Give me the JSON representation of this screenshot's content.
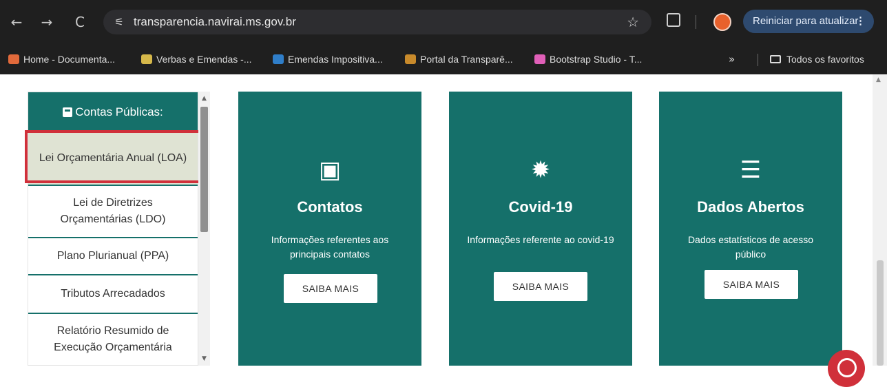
{
  "browser": {
    "nav": {
      "back_icon": "←",
      "forward_icon": "→",
      "reload_icon": "C"
    },
    "site_info_icon": "⚟",
    "url": "transparencia.navirai.ms.gov.br",
    "star_icon": "☆",
    "update_button": "Reiniciar para atualizar",
    "update_menu": "⋮"
  },
  "bookmarks": {
    "items": [
      {
        "label": "Home - Documenta...",
        "color": "#e26a3b"
      },
      {
        "label": "Verbas e Emendas -...",
        "color": "#d6b84a"
      },
      {
        "label": "Emendas Impositiva...",
        "color": "#2f7ec9"
      },
      {
        "label": "Portal da Transparê...",
        "color": "#c88a2b"
      },
      {
        "label": "Bootstrap Studio - T...",
        "color": "#e05fb8"
      }
    ],
    "more": "»",
    "all_label": "Todos os favoritos"
  },
  "sidebar": {
    "title": "Contas Públicas:",
    "items": [
      {
        "label": "Lei Orçamentária Anual (LOA)"
      },
      {
        "label": "Lei de Diretrizes Orçamentárias (LDO)"
      },
      {
        "label": "Plano Plurianual (PPA)"
      },
      {
        "label": "Tributos Arrecadados"
      },
      {
        "label": "Relatório Resumido de Execução Orçamentária"
      }
    ],
    "scroll_up": "▲",
    "scroll_down": "▼"
  },
  "cards": [
    {
      "icon": "▣",
      "title": "Contatos",
      "desc": "Informações referentes aos principais contatos",
      "button": "SAIBA MAIS"
    },
    {
      "icon": "✹",
      "title": "Covid-19",
      "desc": "Informações referente ao covid-19",
      "button": "SAIBA MAIS"
    },
    {
      "icon": "☰",
      "title": "Dados Abertos",
      "desc": "Dados estatísticos de acesso público",
      "button": "SAIBA MAIS"
    }
  ],
  "page_scroll_up": "▲",
  "colors": {
    "teal": "#15706a",
    "highlight_red": "#d0303a",
    "active_item_bg": "#dfe3d3"
  }
}
